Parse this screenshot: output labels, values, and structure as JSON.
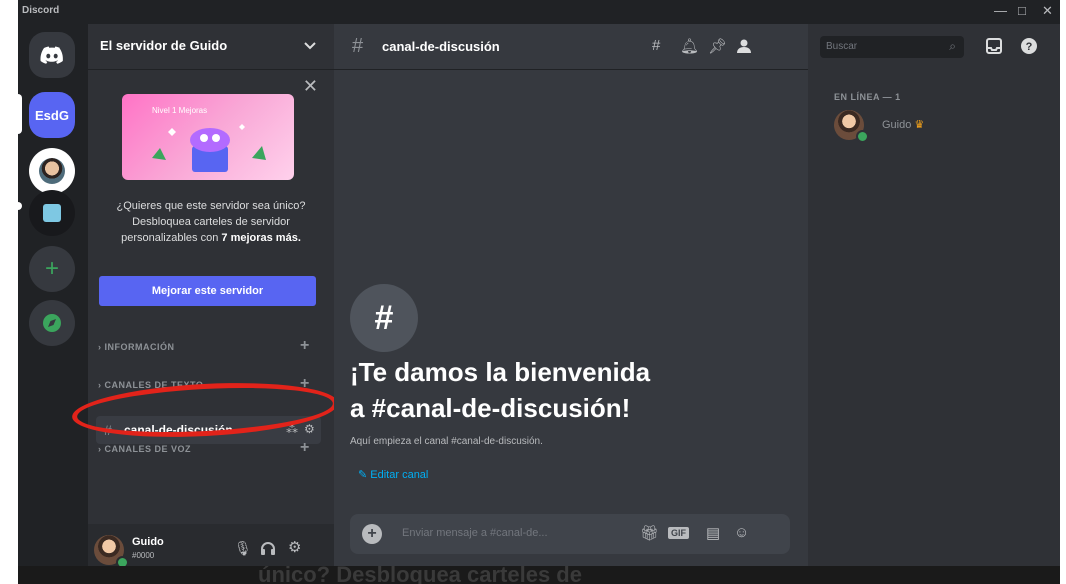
{
  "window": {
    "app_name": "Discord",
    "min": "—",
    "max": "□",
    "close": "✕"
  },
  "guilds": [
    {
      "label": "EsdG"
    }
  ],
  "server": {
    "name": "El servidor de Guido",
    "promo": {
      "close": "✕",
      "image_caption": "Nivel 1 Mejoras",
      "text_start": "¿Quieres que este servidor sea único? Desbloquea carteles de servidor personalizables con ",
      "text_bold": "7 mejoras más.",
      "button": "Mejorar este servidor"
    },
    "categories": [
      {
        "label": "INFORMACIÓN",
        "plus": "+"
      },
      {
        "label": "CANALES DE TEXTO",
        "plus": "+"
      },
      {
        "label": "CANALES DE VOZ",
        "plus": "+"
      }
    ],
    "active_channel": "canal-de-discusión"
  },
  "user": {
    "name": "Guido",
    "tag": "#0000"
  },
  "channel_header": {
    "name": "canal-de-discusión"
  },
  "main": {
    "welcome_line1": "¡Te damos la bienvenida",
    "welcome_line2": "a #canal-de-discusión!",
    "subtitle": "Aquí empieza el canal #canal-de-discusión.",
    "edit_label": "Editar canal",
    "composer_placeholder": "Enviar mensaje a #canal-de..."
  },
  "search": {
    "placeholder": "Buscar"
  },
  "members": {
    "category": "EN LÍNEA — 1",
    "list": [
      {
        "name": "Guido"
      }
    ]
  },
  "bottom_text": "único? Desbloquea carteles de",
  "colors": {
    "accent": "#5865f2",
    "online": "#3ba55d",
    "highlight_ring": "#e2231a",
    "link": "#00aff4"
  }
}
